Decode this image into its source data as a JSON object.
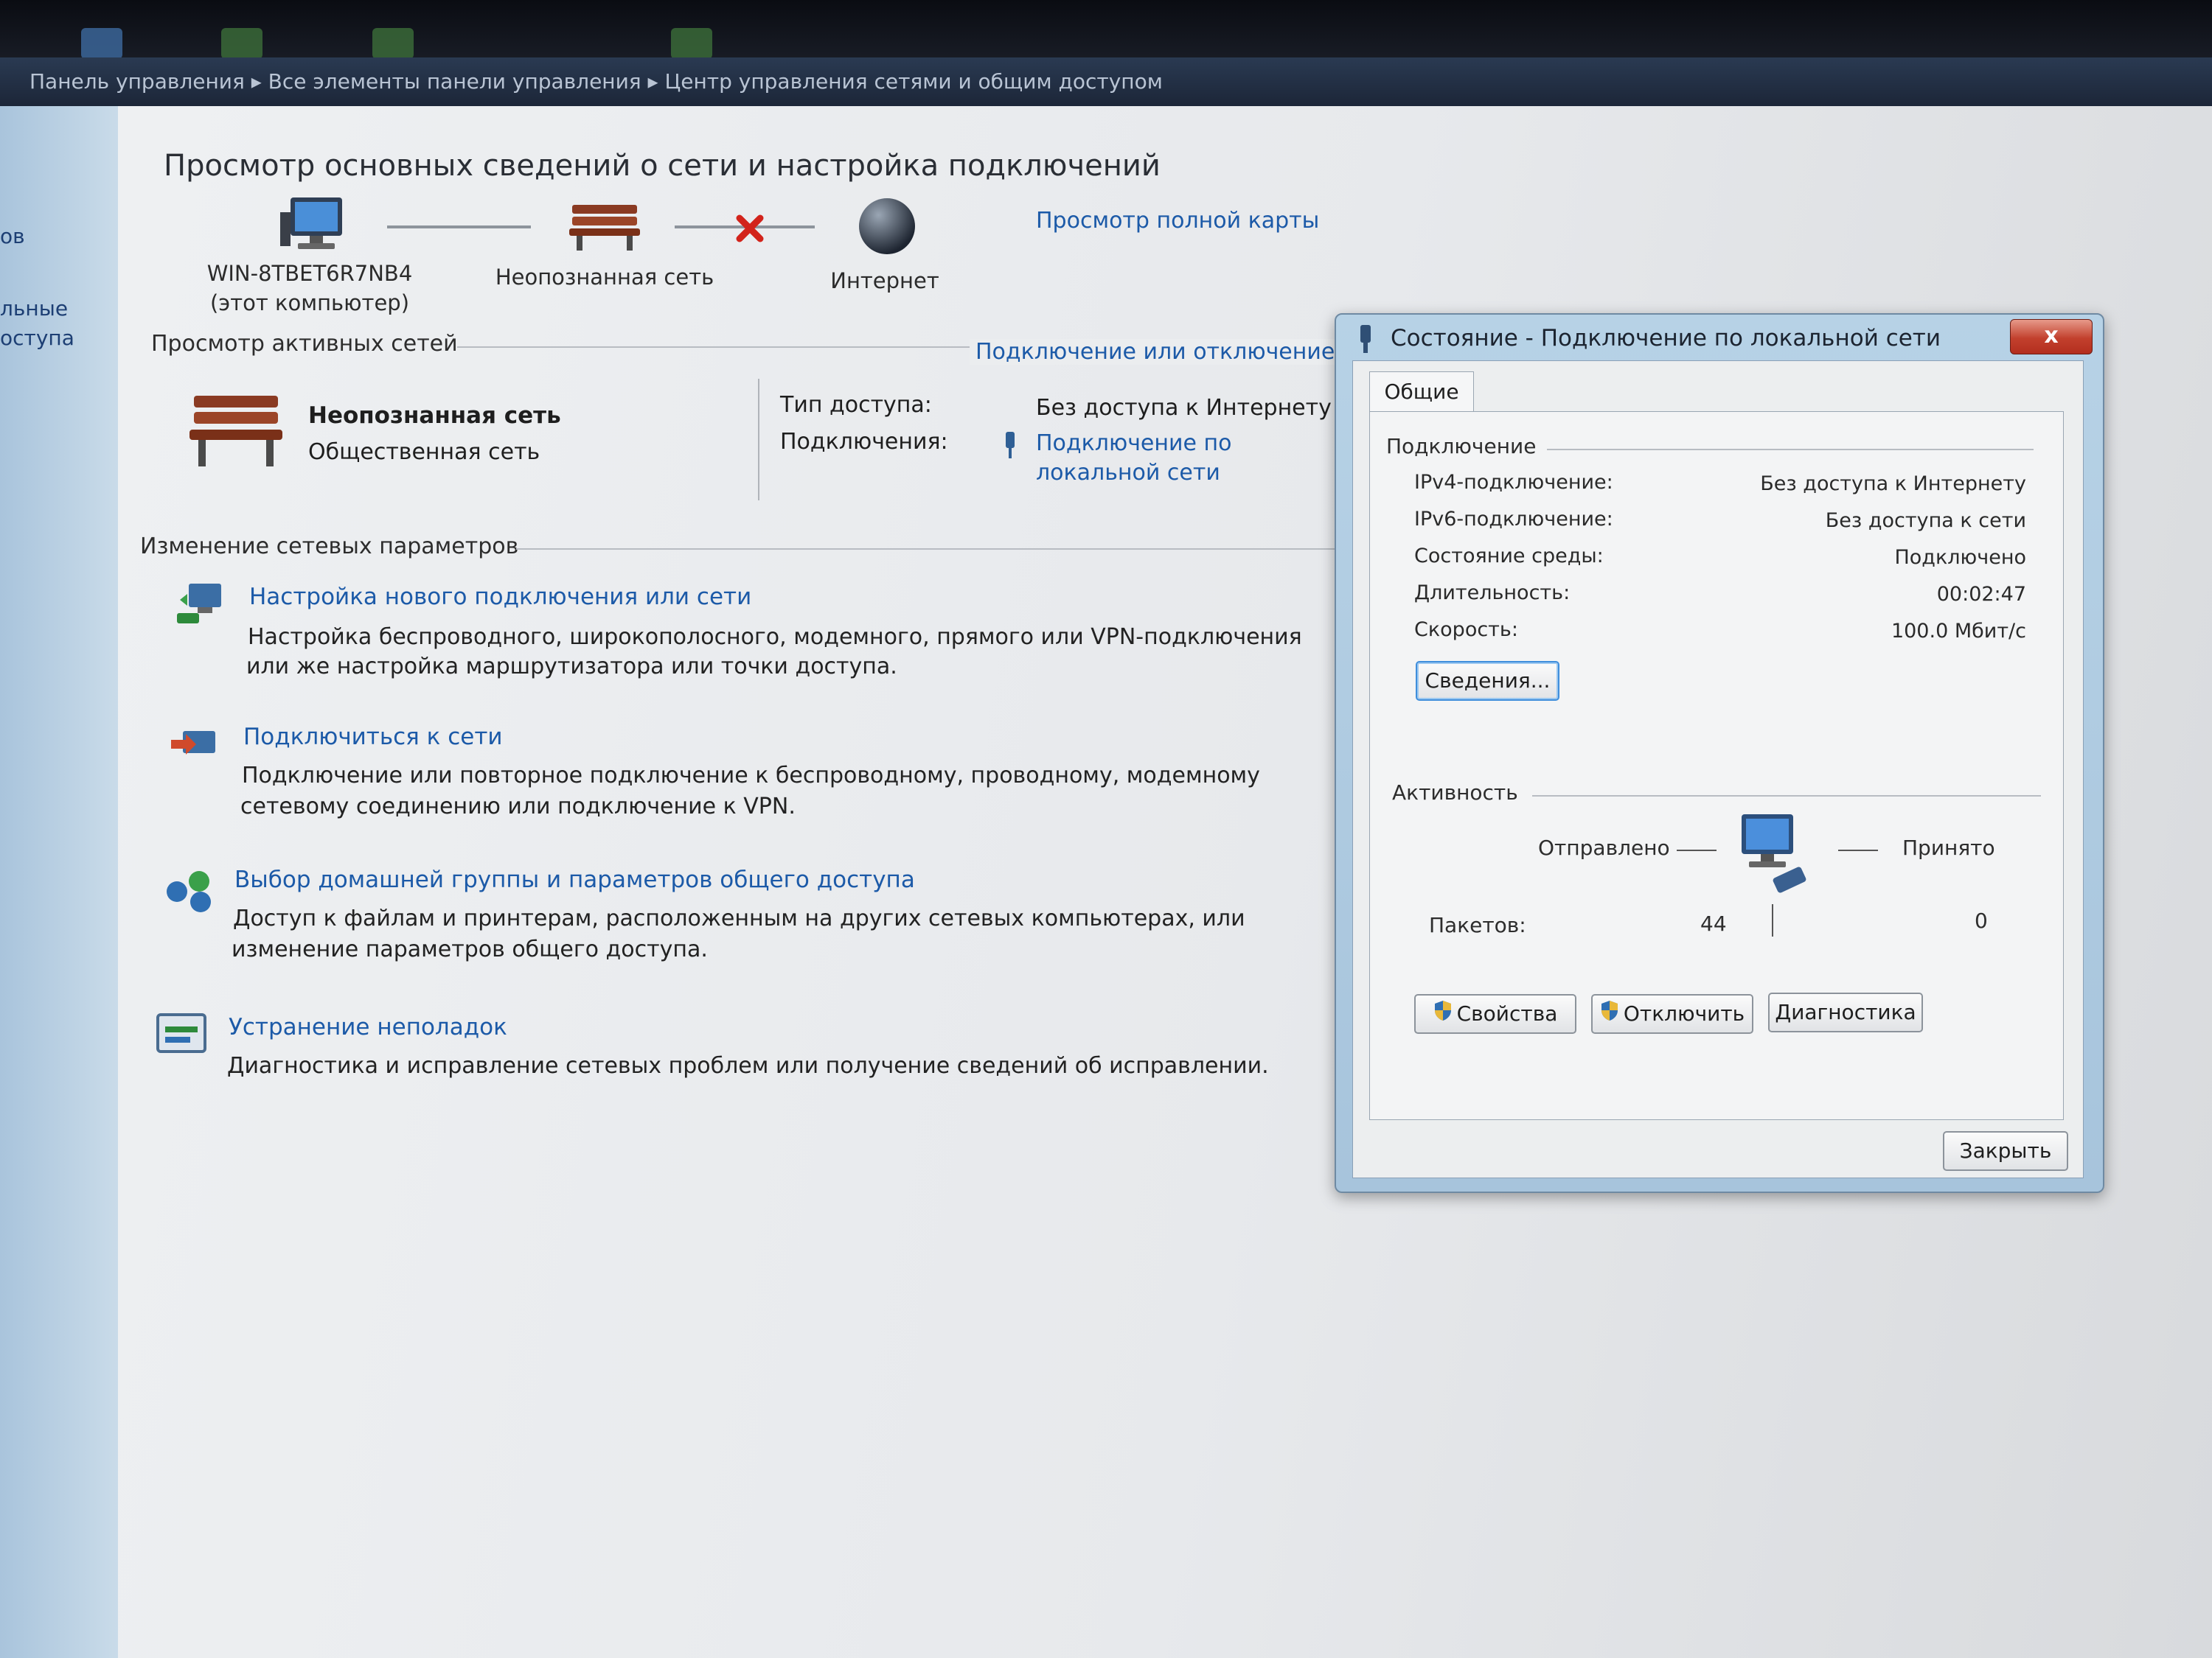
{
  "breadcrumb": {
    "text": "Панель управления ▸ Все элементы панели управления ▸ Центр управления сетями и общим доступом"
  },
  "sidebar": {
    "items": [
      {
        "label": "ов"
      },
      {
        "label": "льные"
      },
      {
        "label": "оступа"
      }
    ]
  },
  "main": {
    "title": "Просмотр основных сведений о сети и настройка подключений",
    "map": {
      "computer_name": "WIN-8TBET6R7NB4",
      "computer_sub": "(этот компьютер)",
      "network_label": "Неопознанная сеть",
      "internet_label": "Интернет",
      "full_map_link": "Просмотр полной карты"
    },
    "active": {
      "heading": "Просмотр активных сетей",
      "connect_link": "Подключение или отключение",
      "network_name": "Неопознанная сеть",
      "network_type": "Общественная сеть",
      "access_type_label": "Тип доступа:",
      "access_type_value": "Без доступа к Интернету",
      "connections_label": "Подключения:",
      "connections_link_1": "Подключение по",
      "connections_link_2": "локальной сети"
    },
    "change": {
      "heading": "Изменение сетевых параметров",
      "tasks": [
        {
          "link": "Настройка нового подключения или сети",
          "desc_1": "Настройка беспроводного, широкополосного, модемного, прямого или VPN-подключения",
          "desc_2": "или же настройка маршрутизатора или точки доступа."
        },
        {
          "link": "Подключиться к сети",
          "desc_1": "Подключение или повторное подключение к беспроводному, проводному, модемному",
          "desc_2": "сетевому соединению или подключение к VPN."
        },
        {
          "link": "Выбор домашней группы и параметров общего доступа",
          "desc_1": "Доступ к файлам и принтерам, расположенным на других сетевых компьютерах, или",
          "desc_2": "изменение параметров общего доступа."
        },
        {
          "link": "Устранение неполадок",
          "desc_1": "Диагностика и исправление сетевых проблем или получение сведений об исправлении.",
          "desc_2": ""
        }
      ]
    }
  },
  "dialog": {
    "title": "Состояние - Подключение по локальной сети",
    "close_label": "x",
    "tab": "Общие",
    "connection": {
      "heading": "Подключение",
      "rows": [
        {
          "label": "IPv4-подключение:",
          "value": "Без доступа к Интернету"
        },
        {
          "label": "IPv6-подключение:",
          "value": "Без доступа к сети"
        },
        {
          "label": "Состояние среды:",
          "value": "Подключено"
        },
        {
          "label": "Длительность:",
          "value": "00:02:47"
        },
        {
          "label": "Скорость:",
          "value": "100.0 Мбит/с"
        }
      ],
      "details_button": "Сведения..."
    },
    "activity": {
      "heading": "Активность",
      "sent_label": "Отправлено",
      "received_label": "Принято",
      "packets_label": "Пакетов:",
      "packets_sent": "44",
      "packets_received": "0"
    },
    "buttons": {
      "properties": "Свойства",
      "disable": "Отключить",
      "diagnose": "Диагностика",
      "close": "Закрыть"
    }
  },
  "colors": {
    "link": "#1c5aa8",
    "dialog_frame": "#a7c4dc",
    "close_red": "#c2402d"
  }
}
